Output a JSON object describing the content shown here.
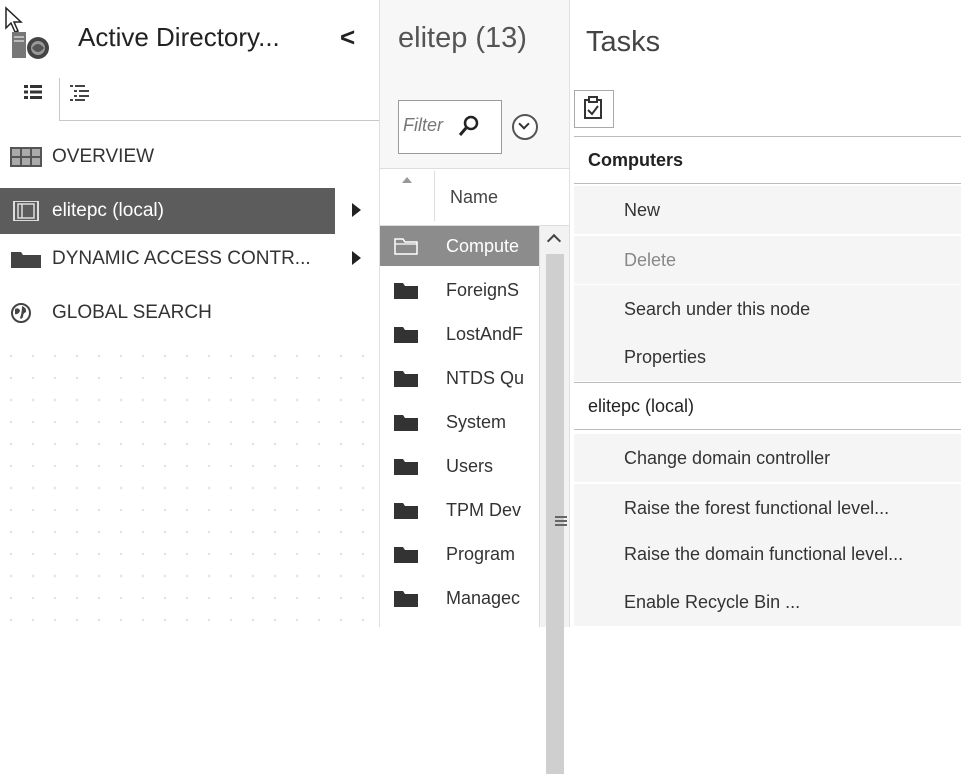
{
  "nav": {
    "title": "Active Directory...",
    "collapse_glyph": "<",
    "items": [
      {
        "label": "OVERVIEW",
        "icon": "overview-grid-icon",
        "selected": false,
        "has_arrow": false
      },
      {
        "label": "elitepc (local)",
        "icon": "domain-icon",
        "selected": true,
        "has_arrow": true
      },
      {
        "label": "DYNAMIC ACCESS CONTR...",
        "icon": "folder-icon",
        "selected": false,
        "has_arrow": true
      },
      {
        "label": "GLOBAL SEARCH",
        "icon": "globe-icon",
        "selected": false,
        "has_arrow": false
      }
    ]
  },
  "list": {
    "title": "elitep",
    "count": "(13)",
    "filter_placeholder": "Filter",
    "column_name": "Name",
    "rows": [
      {
        "label": "Compute",
        "selected": true
      },
      {
        "label": "ForeignS",
        "selected": false
      },
      {
        "label": "LostAndF",
        "selected": false
      },
      {
        "label": "NTDS Qu",
        "selected": false
      },
      {
        "label": "System",
        "selected": false
      },
      {
        "label": "Users",
        "selected": false
      },
      {
        "label": "TPM Dev",
        "selected": false
      },
      {
        "label": "Program",
        "selected": false
      },
      {
        "label": "Managec",
        "selected": false
      }
    ]
  },
  "tasks": {
    "title": "Tasks",
    "sections": [
      {
        "header": "Computers",
        "items": [
          {
            "label": "New",
            "enabled": true
          },
          {
            "label": "Delete",
            "enabled": false
          },
          {
            "label": "Search under this node",
            "enabled": true
          },
          {
            "label": "Properties",
            "enabled": true
          }
        ]
      },
      {
        "header": "elitepc (local)",
        "items": [
          {
            "label": "Change domain controller",
            "enabled": true
          },
          {
            "label": "Raise the forest functional level...",
            "enabled": true
          },
          {
            "label": "Raise the domain functional level...",
            "enabled": true
          },
          {
            "label": "Enable Recycle Bin ...",
            "enabled": true
          }
        ]
      }
    ]
  },
  "colors": {
    "selected_nav": "#5c5c5c",
    "selected_row": "#8c8c8c",
    "task_item_bg": "#f5f5f5"
  }
}
